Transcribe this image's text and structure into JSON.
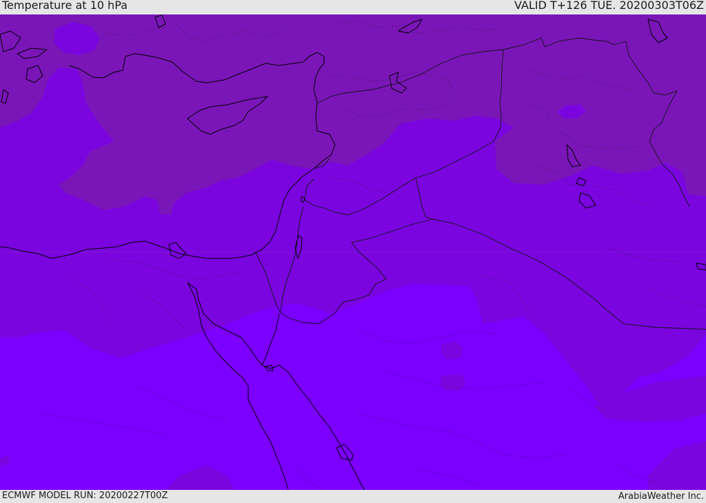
{
  "header": {
    "title": "Temperature at 10 hPa",
    "valid_label": "VALID T+126 TUE. 20200303T06Z"
  },
  "footer": {
    "model_run": "ECMWF MODEL RUN: 20200227T00Z",
    "provider": "ArabiaWeather Inc."
  },
  "map": {
    "field": "Temperature at 10 hPa",
    "colors": {
      "band_warm": "#7a15b8",
      "band_mid": "#7a05df",
      "band_cold": "#7b00ff",
      "coastline": "#000000",
      "inner_border": "#141414"
    }
  }
}
